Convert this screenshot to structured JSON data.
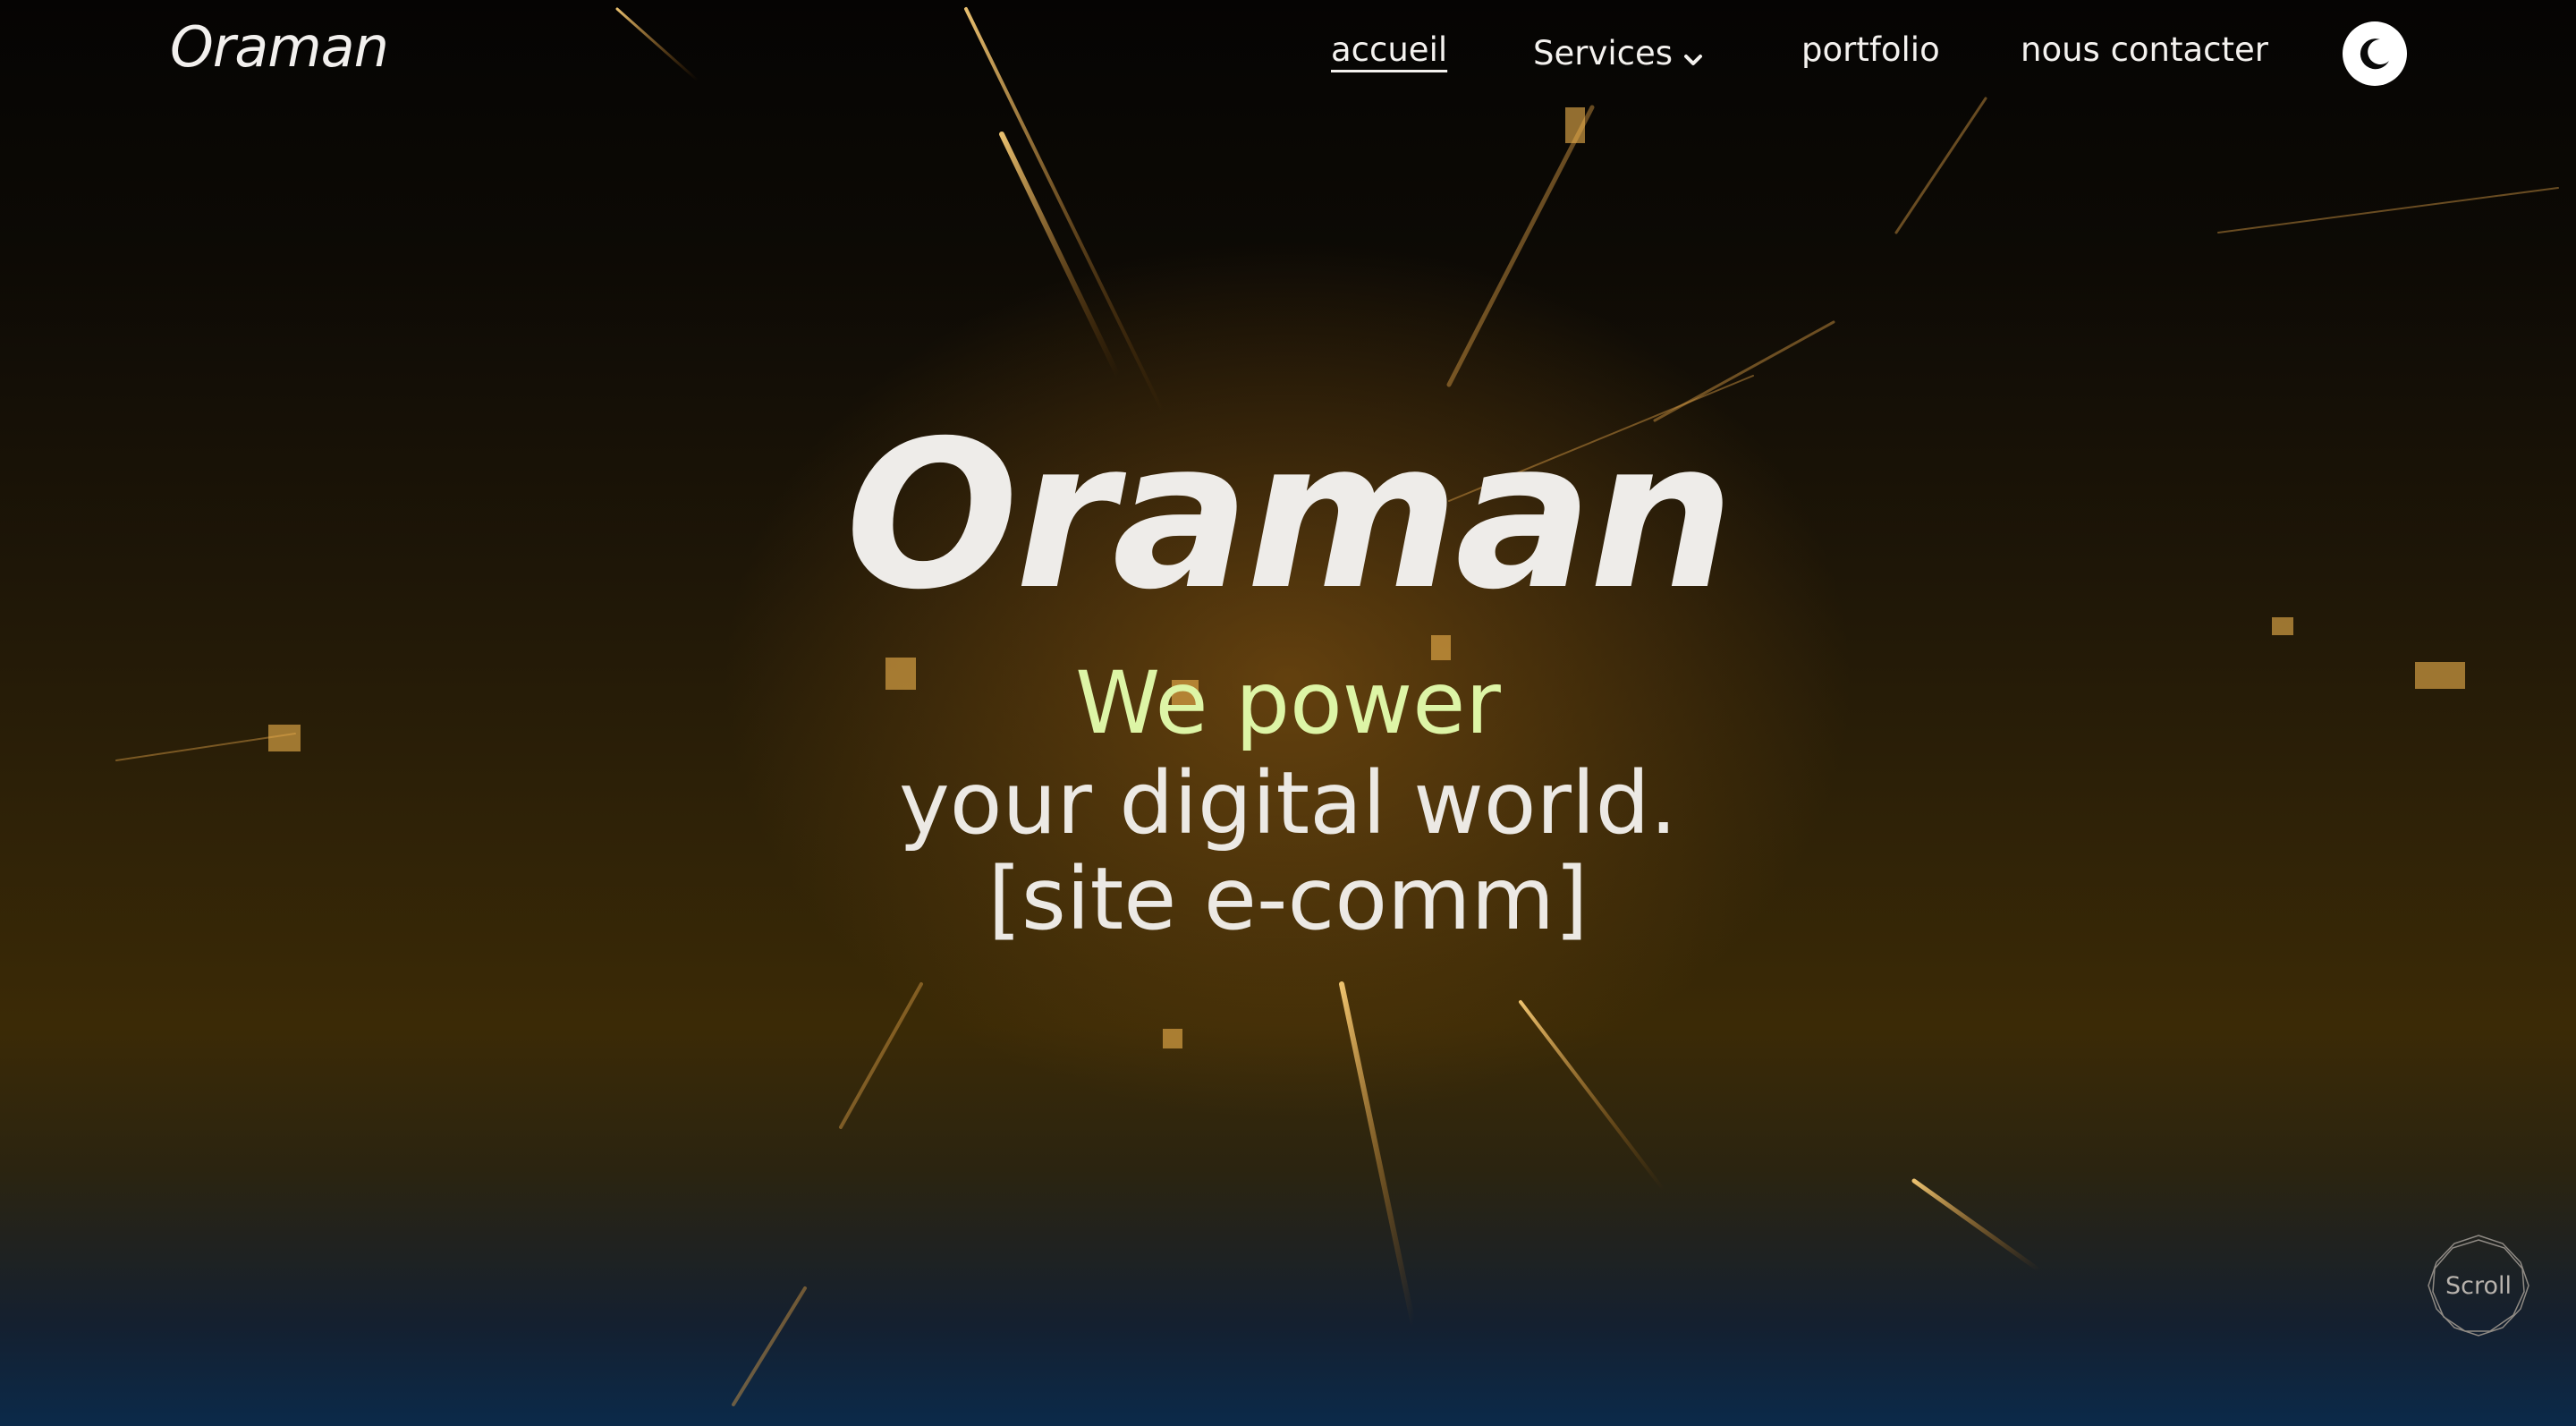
{
  "header": {
    "logo": "Oraman",
    "nav": {
      "accueil": "accueil",
      "services": "Services",
      "portfolio": "portfolio",
      "contact": "nous contacter"
    },
    "theme_toggle_icon": "moon-icon"
  },
  "hero": {
    "title": "Oraman",
    "tagline_highlight": "We power",
    "tagline_line2": "your digital world.",
    "tagline_line3": "[site e-comm]"
  },
  "scroll": {
    "label": "Scroll"
  },
  "colors": {
    "accent": "#ddf5a6",
    "text": "#ece9e4",
    "glow": "#e8a53a"
  }
}
